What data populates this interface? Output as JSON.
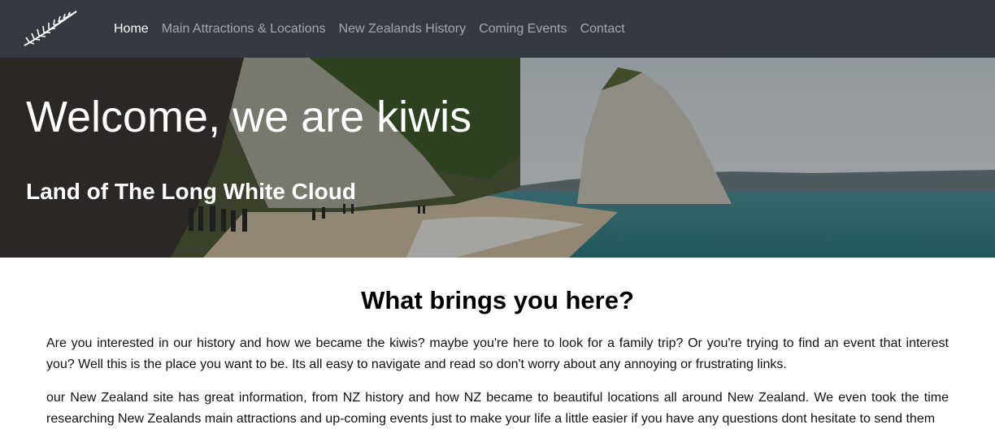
{
  "nav": {
    "logo_icon": "silver-fern-icon",
    "items": [
      {
        "label": "Home",
        "active": true
      },
      {
        "label": "Main Attractions & Locations",
        "active": false
      },
      {
        "label": "New Zealands History",
        "active": false
      },
      {
        "label": "Coming Events",
        "active": false
      },
      {
        "label": "Contact",
        "active": false
      }
    ]
  },
  "hero": {
    "title": "Welcome, we are kiwis",
    "subtitle": "Land of The Long White Cloud"
  },
  "main": {
    "heading": "What brings you here?",
    "paragraphs": [
      "Are you interested in our history and how we became the kiwis? maybe you're here to look for a family trip? Or you're trying to find an event that interest you? Well this is the place you want to be. Its all easy to navigate and read so don't worry about any annoying or frustrating links.",
      "our New Zealand site has great information, from NZ history and how NZ became to beautiful locations all around New Zealand. We even took the time researching New Zealands main attractions and up-coming events just to make your life a little easier if you have any questions dont hesitate to send them"
    ]
  },
  "colors": {
    "navbar": "#343a40",
    "nav_active": "#ffffff",
    "nav_inactive": "#9a9da0"
  }
}
